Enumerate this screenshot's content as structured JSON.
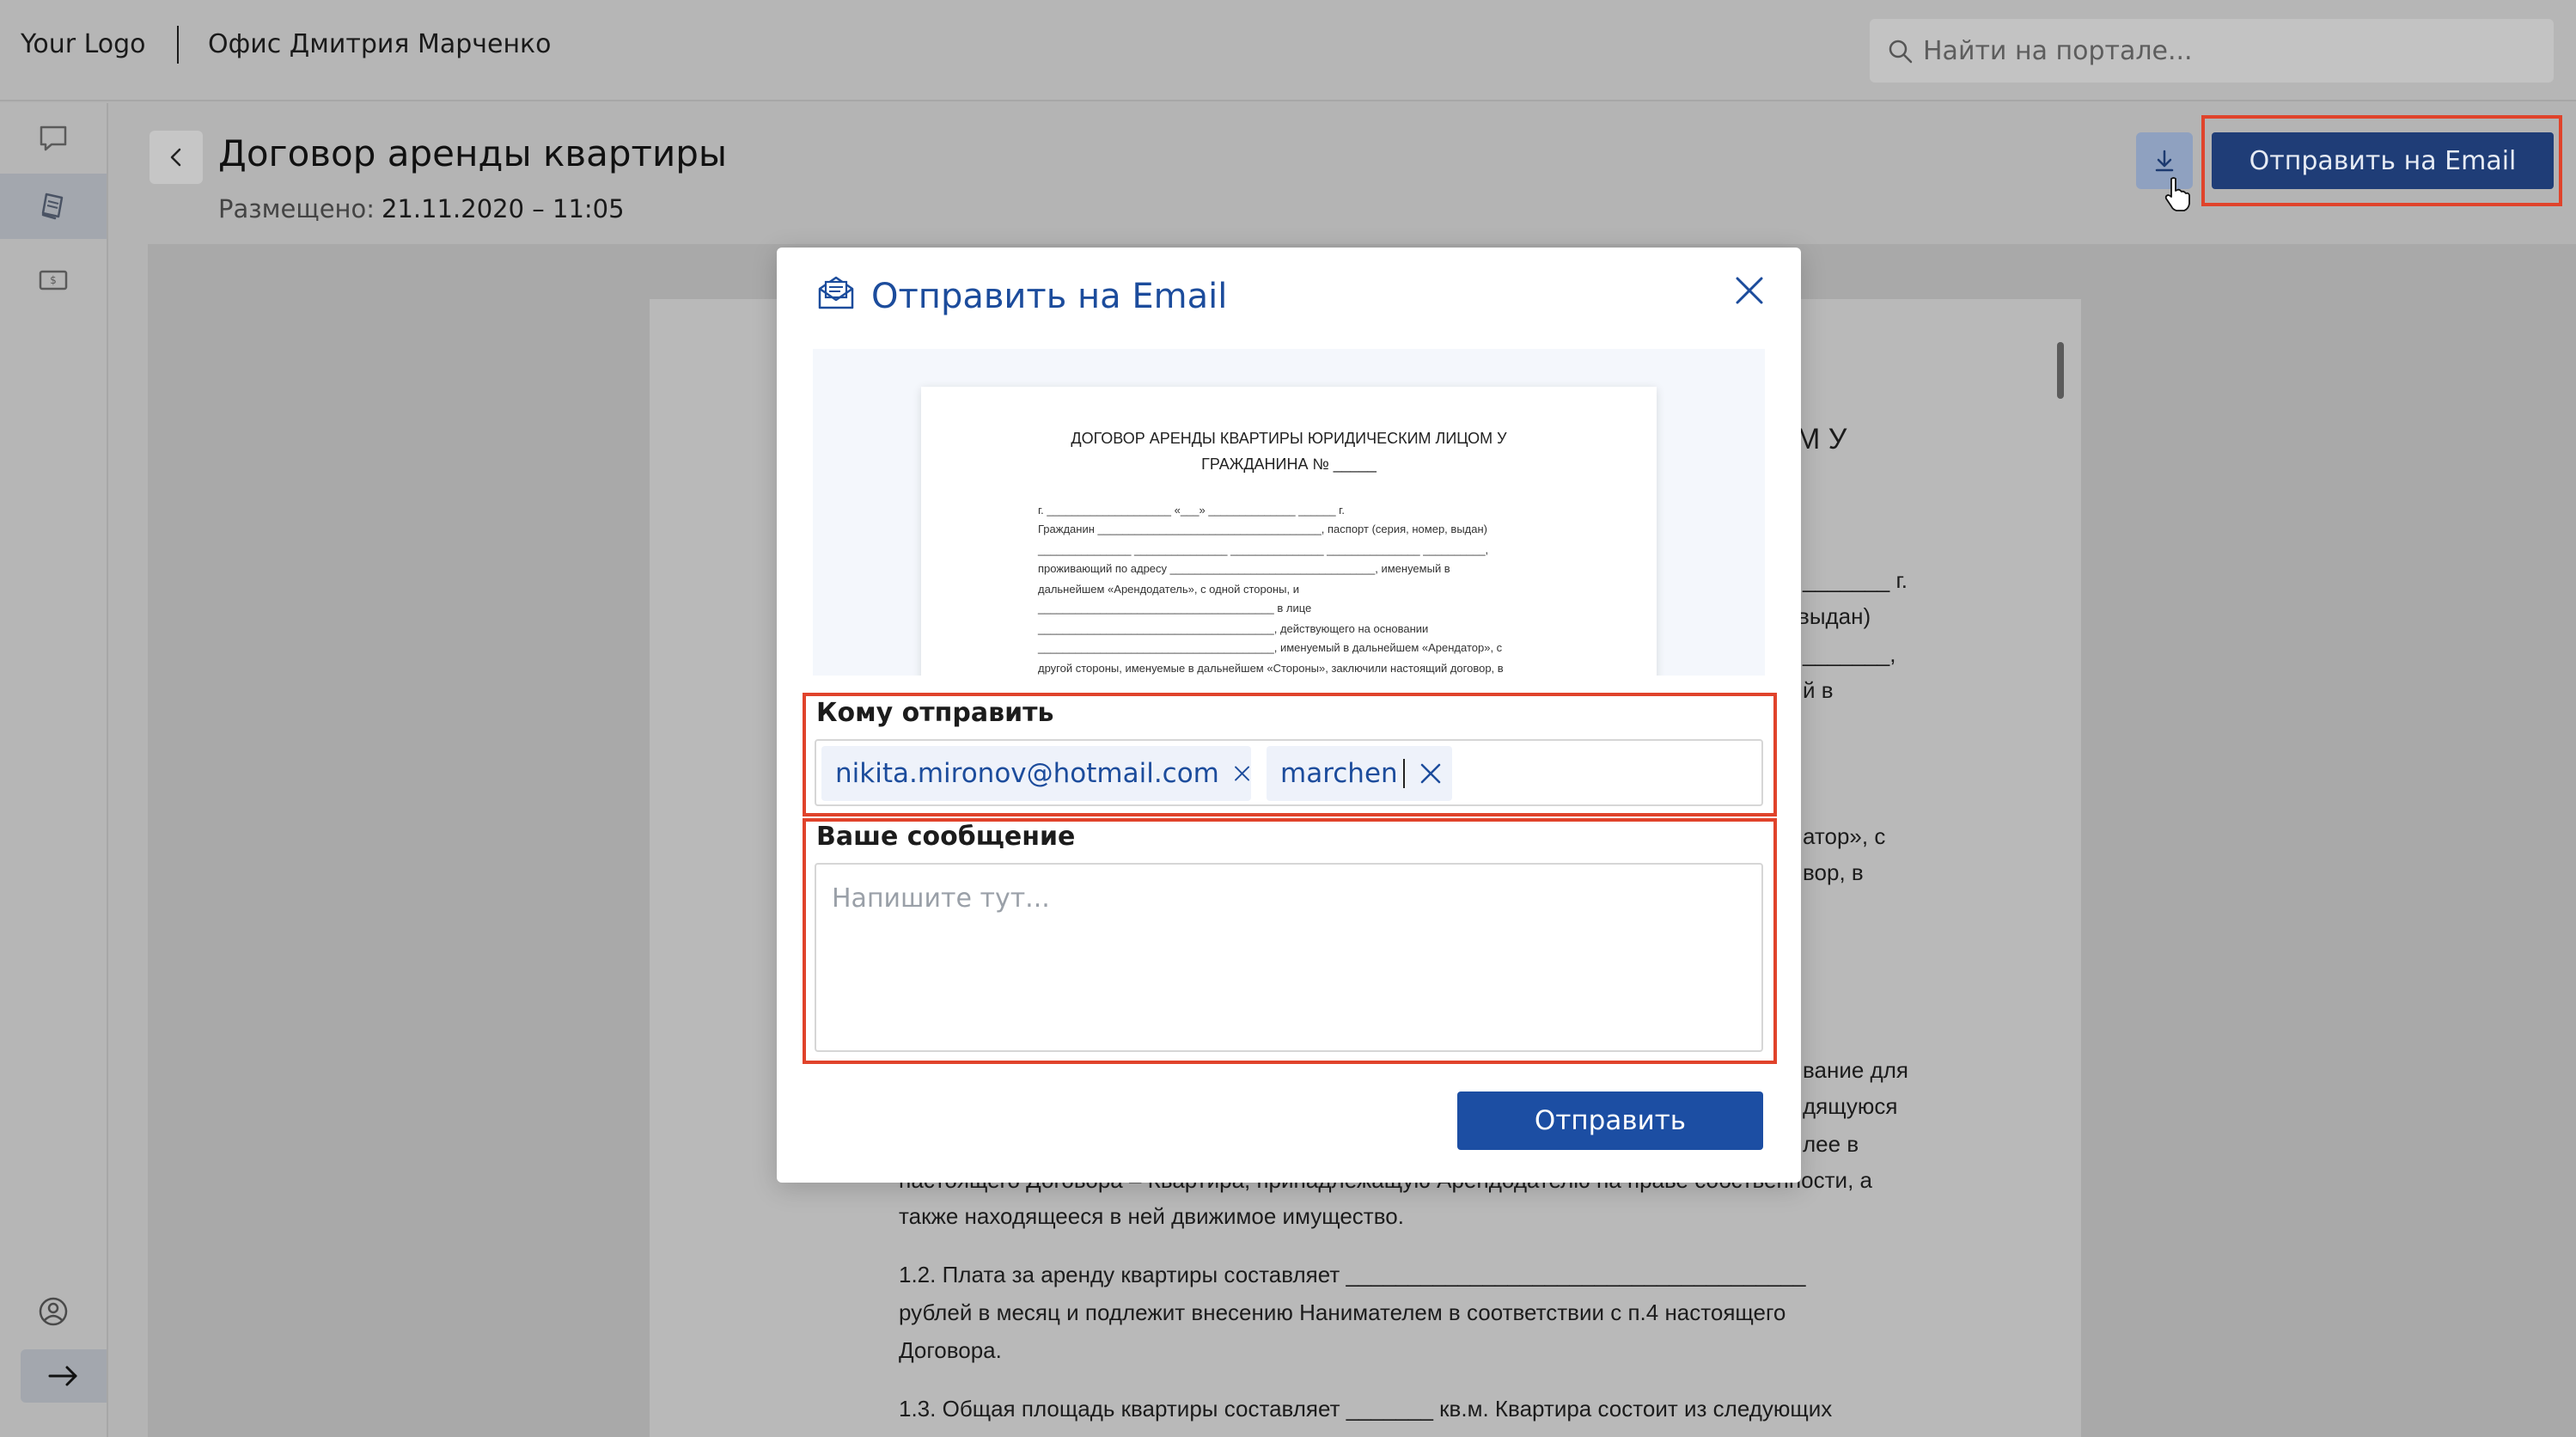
{
  "header": {
    "logo": "Your Logo",
    "office": "Офис Дмитрия Марченко",
    "search_placeholder": "Найти на портале..."
  },
  "sidebar": {
    "items": [
      {
        "icon": "chat-icon",
        "active": false
      },
      {
        "icon": "documents-icon",
        "active": true
      },
      {
        "icon": "payment-icon",
        "active": false
      },
      {
        "icon": "user-icon",
        "active": false
      },
      {
        "icon": "arrow-right-icon",
        "active": false
      }
    ]
  },
  "page": {
    "title": "Договор аренды квартиры",
    "posted_label": "Размещено:",
    "posted_value": "21.11.2020 – 11:05",
    "send_email_label": "Отправить на Email"
  },
  "document": {
    "fragments": [
      "М У",
      "_______ г.",
      "выдан)",
      "_______,",
      "й в",
      "атор», с",
      "вор, в",
      "вание для",
      "дящуюся",
      "лее в",
      "настоящего Договора – Квартира, принадлежащую Арендодателю на праве собственности, а",
      "также находящееся в ней движимое имущество.",
      "1.2. Плата за аренду квартиры составляет _____________________________________",
      "рублей в месяц и подлежит внесению Нанимателем в соответствии с п.4 настоящего",
      "Договора.",
      "1.3. Общая площадь квартиры составляет _______ кв.м. Квартира состоит из следующих"
    ]
  },
  "modal": {
    "title": "Отправить на Email",
    "preview": {
      "title_line1": "ДОГОВОР АРЕНДЫ КВАРТИРЫ ЮРИДИЧЕСКИМ ЛИЦОМ У",
      "title_line2": "ГРАЖДАНИНА № _____",
      "lines": [
        "г. ____________________                           «___» ______________ ______ г.",
        "Гражданин ____________________________________, паспорт (серия, номер, выдан)",
        "_______________ _______________ _______________ _______________ __________,",
        "проживающий по адресу _________________________________, именуемый в",
        "дальнейшем «Арендодатель», с одной стороны, и",
        "______________________________________ в лице",
        "______________________________________, действующего на основании",
        "______________________________________, именуемый в дальнейшем «Арендатор», с",
        "другой стороны, именуемые в дальнейшем «Стороны», заключили настоящий договор, в"
      ]
    },
    "to_label": "Кому отправить",
    "recipients": [
      "nikita.mironov@hotmail.com",
      "marchen"
    ],
    "message_label": "Ваше сообщение",
    "message_placeholder": "Напишите тут...",
    "submit_label": "Отправить"
  },
  "colors": {
    "accent": "#1c4ea3",
    "highlight": "#e0432b",
    "overlay": "#b4b4b4"
  }
}
